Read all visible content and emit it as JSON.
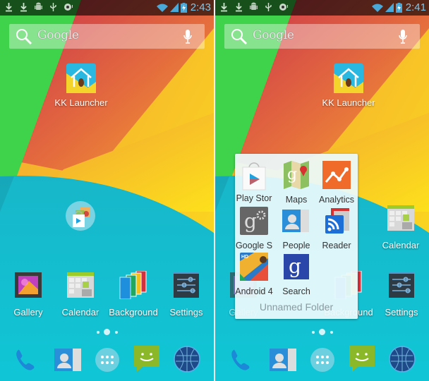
{
  "screens": [
    {
      "status": {
        "left_icons": [
          "download-icon",
          "download-icon",
          "android-debug-icon",
          "usb-icon",
          "sync-icon"
        ],
        "right_icons": [
          "wifi-icon",
          "signal-icon",
          "battery-charging-icon"
        ],
        "time": "2:43"
      },
      "search": {
        "placeholder": "Google",
        "mic": "mic-icon"
      },
      "kk_launcher": {
        "label": "KK Launcher"
      },
      "folder_icon": {
        "label": ""
      },
      "apps": [
        {
          "label": "Gallery",
          "icon": "gallery-icon"
        },
        {
          "label": "Calendar",
          "icon": "calendar-icon"
        },
        {
          "label": "Background",
          "icon": "background-icon"
        },
        {
          "label": "Settings",
          "icon": "settings-icon"
        }
      ],
      "page_indicator": {
        "pages": 3,
        "current": 2
      },
      "dock": [
        "phone-icon",
        "contacts-icon",
        "app-drawer-icon",
        "messaging-icon",
        "browser-icon"
      ]
    },
    {
      "status": {
        "left_icons": [
          "download-icon",
          "download-icon",
          "android-debug-icon",
          "usb-icon",
          "sync-icon"
        ],
        "right_icons": [
          "wifi-icon",
          "signal-icon",
          "battery-charging-icon"
        ],
        "time": "2:41"
      },
      "search": {
        "placeholder": "Google",
        "mic": "mic-icon"
      },
      "kk_launcher": {
        "label": "KK Launcher"
      },
      "apps_visible": [
        {
          "label": "Calendar",
          "icon": "calendar-icon"
        },
        {
          "label": "Gallery",
          "icon": "gallery-icon"
        },
        {
          "label": "Background",
          "icon": "background-icon"
        },
        {
          "label": "Settings",
          "icon": "settings-icon"
        }
      ],
      "folder": {
        "name": "Unnamed Folder",
        "items": [
          {
            "label": "Play Stor",
            "icon": "play-store-icon"
          },
          {
            "label": "Maps",
            "icon": "maps-icon"
          },
          {
            "label": "Analytics",
            "icon": "analytics-icon"
          },
          {
            "label": "Google S",
            "icon": "google-settings-icon"
          },
          {
            "label": "People",
            "icon": "people-icon"
          },
          {
            "label": "Reader",
            "icon": "reader-icon"
          },
          {
            "label": "Android 4",
            "icon": "android-wallpaper-icon"
          },
          {
            "label": "Search",
            "icon": "google-search-icon"
          }
        ]
      },
      "page_indicator": {
        "pages": 3,
        "current": 2
      },
      "dock": [
        "phone-icon",
        "contacts-icon",
        "app-drawer-icon",
        "messaging-icon",
        "browser-icon"
      ]
    }
  ],
  "colors": {
    "status_time": "#7ec6e8",
    "wallpaper_green": "#3fd14a",
    "wallpaper_red": "#d83a55",
    "wallpaper_orange": "#ef9a3a",
    "wallpaper_yellow": "#fcd71e",
    "wallpaper_cyan": "#12c3d2"
  }
}
